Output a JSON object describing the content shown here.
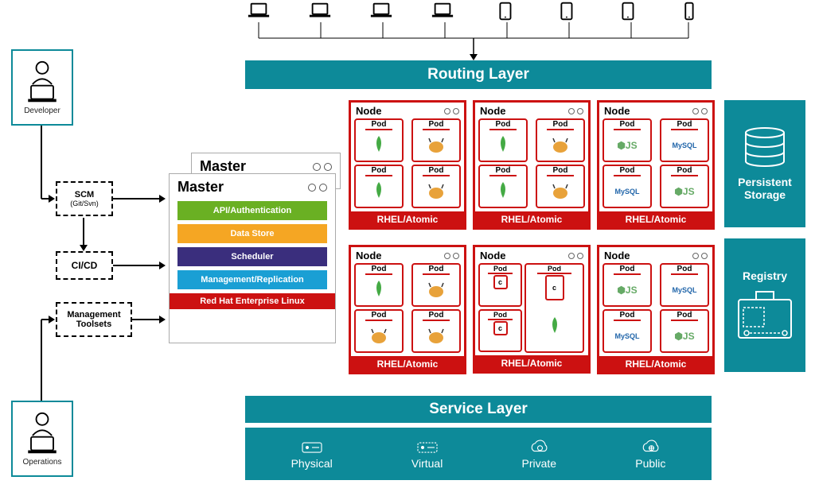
{
  "actors": {
    "developer": "Developer",
    "operations": "Operations"
  },
  "leftBoxes": {
    "scm": {
      "title": "SCM",
      "sub": "(Git/Svn)"
    },
    "cicd": "CI/CD",
    "mgmt": {
      "line1": "Management",
      "line2": "Toolsets"
    }
  },
  "routingLayer": "Routing Layer",
  "master": {
    "title": "Master",
    "backTitle": "Master",
    "rows": {
      "api": "API/Authentication",
      "data": "Data Store",
      "sched": "Scheduler",
      "repl": "Management/Replication"
    },
    "footer": "Red Hat Enterprise Linux"
  },
  "node": {
    "title": "Node",
    "podLabel": "Pod",
    "footer": "RHEL/Atomic",
    "c": "c"
  },
  "tech": {
    "mongo": "mongoDB",
    "tomcat": "tomcat",
    "nodejs": "nodejs",
    "mysql": "MySQL"
  },
  "sideBoxes": {
    "storage": {
      "line1": "Persistent",
      "line2": "Storage"
    },
    "registry": "Registry"
  },
  "serviceLayer": "Service Layer",
  "infra": {
    "physical": "Physical",
    "virtual": "Virtual",
    "private": "Private",
    "public": "Public"
  }
}
